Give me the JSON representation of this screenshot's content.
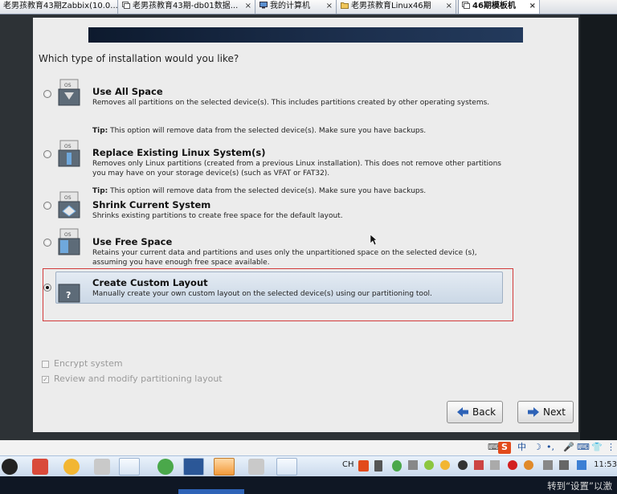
{
  "tabs": [
    {
      "label": "老男孩教育43期Zabbix(10.0...",
      "icon": "vm-icon"
    },
    {
      "label": "老男孩教育43期-db01数据...",
      "icon": "vm-icon"
    },
    {
      "label": "我的计算机",
      "icon": "computer-icon"
    },
    {
      "label": "老男孩教育Linux46期",
      "icon": "folder-icon"
    },
    {
      "label": "46期模板机",
      "icon": "vm-icon",
      "active": true
    }
  ],
  "tab_close": "×",
  "installer": {
    "question": "Which type of installation would you like?",
    "options": [
      {
        "title": "Use All Space",
        "desc": "Removes all partitions on the selected device(s).  This includes partitions created by other operating systems.",
        "tip_label": "Tip:",
        "tip": " This option will remove data from the selected device(s).  Make sure you have backups."
      },
      {
        "title": "Replace Existing Linux System(s)",
        "desc": "Removes only Linux partitions (created from a previous Linux installation).  This does not remove other partitions you may have on your storage device(s) (such as VFAT or FAT32).",
        "tip_label": "Tip:",
        "tip": " This option will remove data from the selected device(s).  Make sure you have backups."
      },
      {
        "title": "Shrink Current System",
        "desc": "Shrinks existing partitions to create free space for the default layout."
      },
      {
        "title": "Use Free Space",
        "desc": "Retains your current data and partitions and uses only the unpartitioned space on the selected device (s), assuming you have enough free space available."
      },
      {
        "title": "Create Custom Layout",
        "desc": "Manually create your own custom layout on the selected device(s) using our partitioning tool.",
        "selected": true
      }
    ],
    "disk_label": "OS",
    "custom_mark": "?",
    "encrypt_label": "Encrypt system",
    "encrypt_checked": false,
    "review_label": "Review and modify partitioning layout",
    "review_checked": true,
    "check_mark": "✓",
    "back_label": "Back",
    "next_label": "Next"
  },
  "ime": {
    "brand": "S",
    "lang": "中",
    "moon": "☽",
    "punct": "•,",
    "mic": "🎤",
    "keyboard": "⌨",
    "shirt": "👕",
    "more": "⋮"
  },
  "tray": {
    "lang": "CH",
    "clock": "11:53"
  },
  "hint": "转到“设置”以激",
  "colors": {
    "banner": "#1c2f4d",
    "selection_outline": "#d23b3b",
    "accent": "#2e63b7"
  }
}
